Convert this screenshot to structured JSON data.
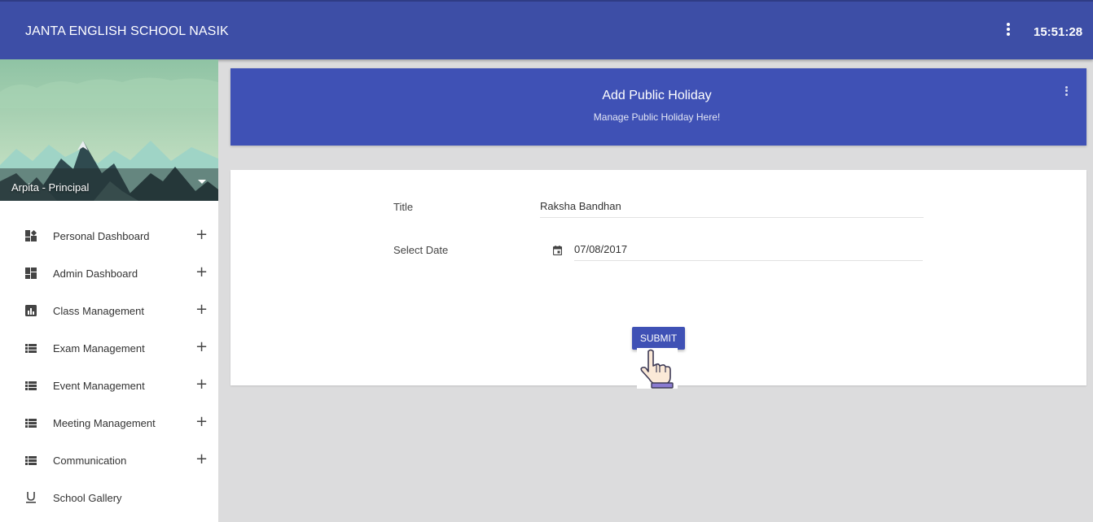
{
  "app": {
    "title": "JANTA ENGLISH SCHOOL NASIK",
    "clock": "15:51:28"
  },
  "profile": {
    "name": "Arpita - Principal"
  },
  "sidebar": {
    "items": [
      {
        "label": "Personal Dashboard",
        "icon": "dashboard-puzzle-icon",
        "expandable": true
      },
      {
        "label": "Admin Dashboard",
        "icon": "dashboard-icon",
        "expandable": true
      },
      {
        "label": "Class Management",
        "icon": "bar-chart-icon",
        "expandable": true
      },
      {
        "label": "Exam Management",
        "icon": "list-icon",
        "expandable": true
      },
      {
        "label": "Event Management",
        "icon": "list-icon",
        "expandable": true
      },
      {
        "label": "Meeting Management",
        "icon": "list-icon",
        "expandable": true
      },
      {
        "label": "Communication",
        "icon": "list-icon",
        "expandable": true
      },
      {
        "label": "School Gallery",
        "icon": "underline-icon",
        "expandable": false
      }
    ],
    "expand_symbol": "+"
  },
  "header": {
    "title": "Add Public Holiday",
    "subtitle": "Manage Public Holiday Here!"
  },
  "form": {
    "title_label": "Title",
    "title_value": "Raksha Bandhan",
    "date_label": "Select Date",
    "date_value": "07/08/2017",
    "submit_label": "SUBMIT"
  },
  "colors": {
    "topbar": "#3d4ea6",
    "accent": "#3f51b5",
    "background": "#dcdcdd"
  }
}
